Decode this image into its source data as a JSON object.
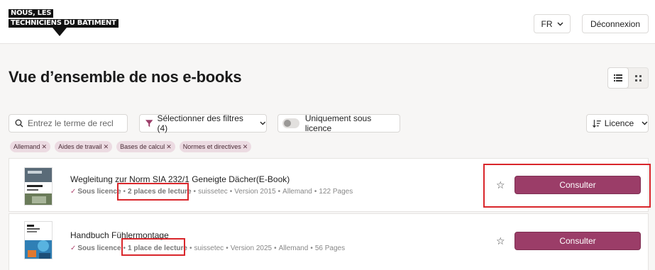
{
  "header": {
    "logo_line1": "NOUS, LES",
    "logo_line2": "TECHNICIENS DU BÂTIMENT",
    "language": "FR",
    "logout_label": "Déconnexion"
  },
  "page": {
    "title": "Vue d’ensemble de nos e-books"
  },
  "toolbar": {
    "search_placeholder": "Entrez le terme de reche",
    "filter_label": "Sélectionner des filtres (4)",
    "licence_only_label": "Uniquement sous licence",
    "sort_label": "Licence"
  },
  "tags": [
    {
      "label": "Allemand"
    },
    {
      "label": "Aides de travail"
    },
    {
      "label": "Bases de calcul"
    },
    {
      "label": "Normes et directives"
    }
  ],
  "books": [
    {
      "title": "Wegleitung zur Norm SIA 232/1 Geneigte Dächer(E-Book)",
      "licence": "Sous licence",
      "places": "2 places de lecture",
      "publisher": "suissetec",
      "version": "Version 2015",
      "language": "Allemand",
      "pages": "122 Pages",
      "action": "Consulter"
    },
    {
      "title": "Handbuch Fühlermontage",
      "licence": "Sous licence",
      "places": "1 place de lecture",
      "publisher": "suissetec",
      "version": "Version 2025",
      "language": "Allemand",
      "pages": "56 Pages",
      "action": "Consulter"
    }
  ],
  "colors": {
    "accent": "#9b3d68",
    "tag_bg": "#ecdbe2",
    "highlight": "#d9262b"
  }
}
